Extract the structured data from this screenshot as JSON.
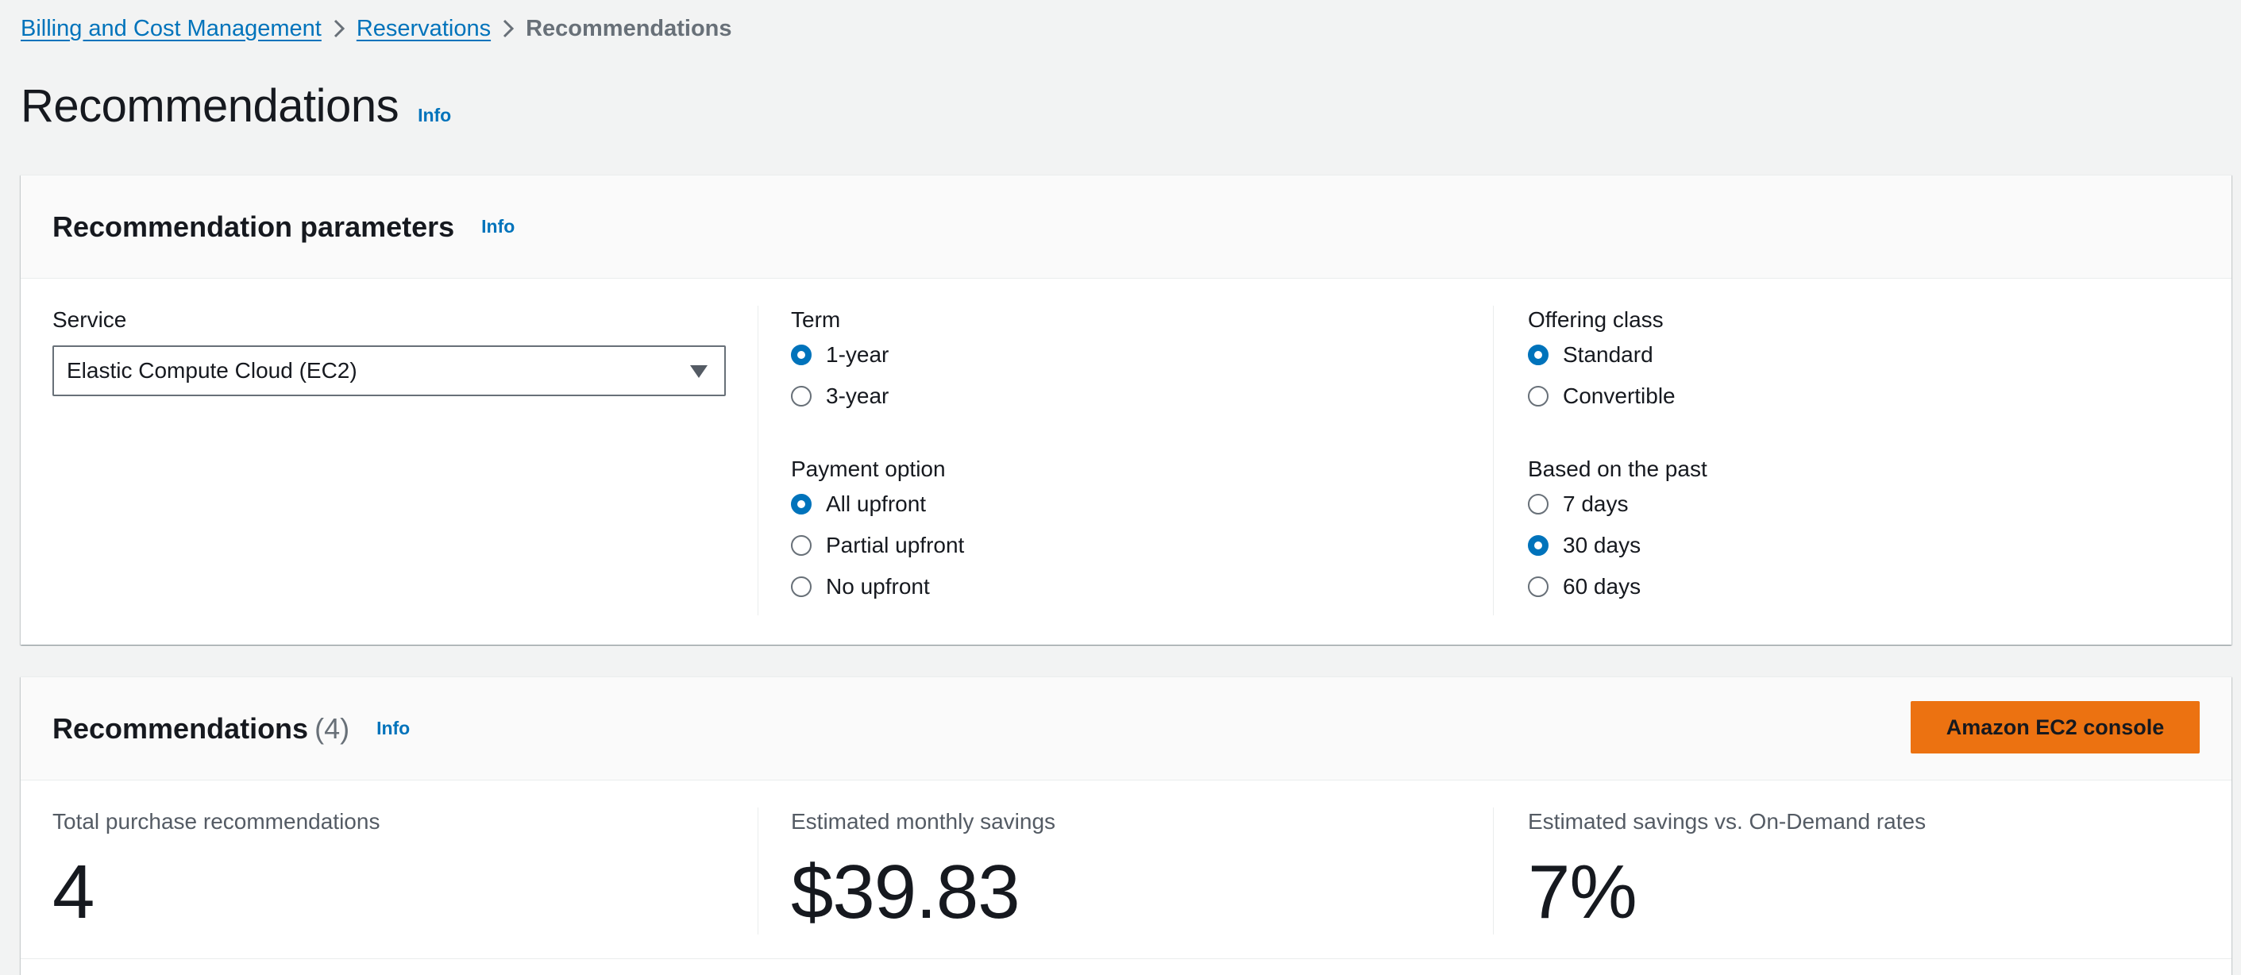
{
  "breadcrumb": {
    "items": [
      {
        "label": "Billing and Cost Management"
      },
      {
        "label": "Reservations"
      },
      {
        "label": "Recommendations"
      }
    ]
  },
  "page": {
    "title": "Recommendations",
    "info": "Info"
  },
  "params_panel": {
    "title": "Recommendation parameters",
    "info": "Info",
    "service": {
      "label": "Service",
      "value": "Elastic Compute Cloud (EC2)"
    },
    "term": {
      "label": "Term",
      "options": [
        {
          "label": "1-year",
          "checked": true
        },
        {
          "label": "3-year",
          "checked": false
        }
      ]
    },
    "offering_class": {
      "label": "Offering class",
      "options": [
        {
          "label": "Standard",
          "checked": true
        },
        {
          "label": "Convertible",
          "checked": false
        }
      ]
    },
    "payment_option": {
      "label": "Payment option",
      "options": [
        {
          "label": "All upfront",
          "checked": true
        },
        {
          "label": "Partial upfront",
          "checked": false
        },
        {
          "label": "No upfront",
          "checked": false
        }
      ]
    },
    "based_on": {
      "label": "Based on the past",
      "options": [
        {
          "label": "7 days",
          "checked": false
        },
        {
          "label": "30 days",
          "checked": true
        },
        {
          "label": "60 days",
          "checked": false
        }
      ]
    }
  },
  "recs_panel": {
    "title": "Recommendations",
    "count": "(4)",
    "info": "Info",
    "console_button": "Amazon EC2 console",
    "metrics": [
      {
        "label": "Total purchase recommendations",
        "value": "4"
      },
      {
        "label": "Estimated monthly savings",
        "value": "$39.83"
      },
      {
        "label": "Estimated savings vs. On-Demand rates",
        "value": "7%"
      }
    ]
  },
  "colors": {
    "link": "#0073bb",
    "accent_button": "#ec7211",
    "background": "#f2f3f3"
  }
}
